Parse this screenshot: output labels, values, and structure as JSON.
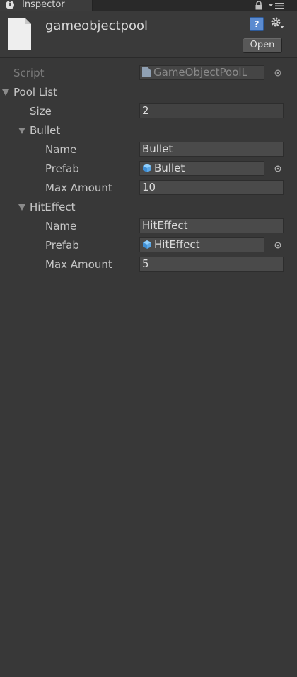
{
  "tab": {
    "label": "Inspector",
    "info_glyph": "i"
  },
  "header": {
    "title": "gameobjectpool",
    "help_glyph": "?",
    "open_label": "Open"
  },
  "script": {
    "label": "Script",
    "value": "GameObjectPoolL"
  },
  "pool_list": {
    "label": "Pool List",
    "size_label": "Size",
    "size_value": "2",
    "items": [
      {
        "header": "Bullet",
        "name_label": "Name",
        "name_value": "Bullet",
        "prefab_label": "Prefab",
        "prefab_value": "Bullet",
        "max_label": "Max Amount",
        "max_value": "10"
      },
      {
        "header": "HitEffect",
        "name_label": "Name",
        "name_value": "HitEffect",
        "prefab_label": "Prefab",
        "prefab_value": "HitEffect",
        "max_label": "Max Amount",
        "max_value": "5"
      }
    ]
  },
  "colors": {
    "background": "#383838",
    "field": "#4a4a4a",
    "prefab_icon": "#5aa8e8"
  }
}
